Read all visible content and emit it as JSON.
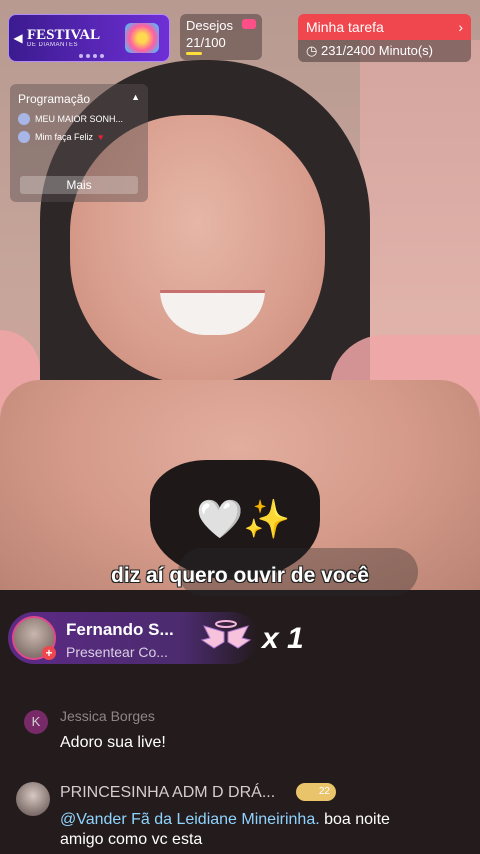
{
  "festival": {
    "title": "FESTIVAL",
    "subtitle": "DE DIAMANTES"
  },
  "desejos": {
    "label": "Desejos",
    "value": "21/100"
  },
  "tarefa": {
    "title": "Minha tarefa",
    "progress": "231/2400 Minuto(s)"
  },
  "programacao": {
    "title": "Programação",
    "items": [
      {
        "label": "MEU MAIOR SONH..."
      },
      {
        "label": "Mim faça Feliz"
      }
    ],
    "more_label": "Mais"
  },
  "caption": "diz aí quero ouvir de você",
  "gift": {
    "user": "Fernando S...",
    "action": "Presentear Co...",
    "count": "x 1"
  },
  "chat": [
    {
      "avatar_letter": "K",
      "user": "Jessica Borges",
      "text": "Adoro sua live!"
    },
    {
      "user": "PRINCESINHA ADM  D DRÁ...",
      "level": "22",
      "mention": "@Vander Fã da Leidiane Mineirinha.",
      "text": " boa noite amigo como vc esta"
    }
  ],
  "colors": {
    "accent_red": "#f0464e",
    "festival_purple": "#6f2fd6",
    "mention_blue": "#8fd4ff"
  }
}
